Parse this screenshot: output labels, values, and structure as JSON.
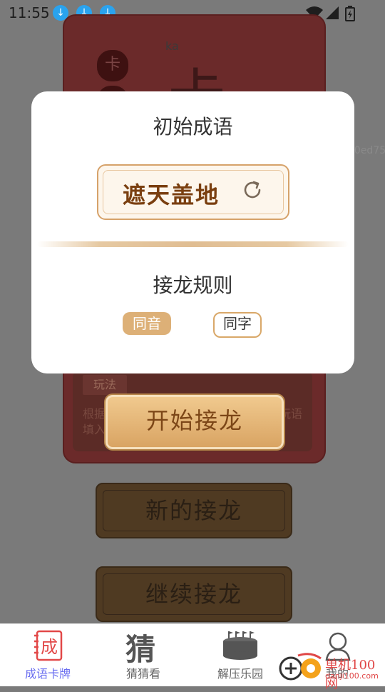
{
  "status_bar": {
    "time": "11:55",
    "download_badges": [
      "↓",
      "↓",
      "↓"
    ]
  },
  "background": {
    "pinyin": "ka",
    "big_char": "卡",
    "circle_char": "卡",
    "rules_tab": "玩法",
    "desc_left_line1": "根据",
    "desc_left_line2": "填入",
    "desc_right": "玩语",
    "start_button": "开始接龙",
    "new_button": "新的接龙",
    "continue_button": "继续接龙",
    "side_code": "10ed75"
  },
  "dialog": {
    "title_initial": "初始成语",
    "idiom": "遮天盖地",
    "rule_title": "接龙规则",
    "options": [
      {
        "label": "同音",
        "selected": true
      },
      {
        "label": "同字",
        "selected": false
      }
    ]
  },
  "tabbar": {
    "tabs": [
      {
        "label": "成语卡牌",
        "icon": "idiom-card-icon",
        "active": true
      },
      {
        "label": "猜猜看",
        "icon": "guess-icon",
        "active": false
      },
      {
        "label": "解压乐园",
        "icon": "stress-relief-icon",
        "active": false
      },
      {
        "label": "我的",
        "icon": "profile-icon",
        "active": false
      }
    ],
    "icon_chars": {
      "card": "成",
      "guess": "猜"
    }
  },
  "watermark": {
    "title": "单机100网",
    "url": "danji100.com"
  },
  "colors": {
    "accent": "#ddb077",
    "idiom_text": "#7a3f10",
    "active_tab": "#6a6ef0"
  }
}
